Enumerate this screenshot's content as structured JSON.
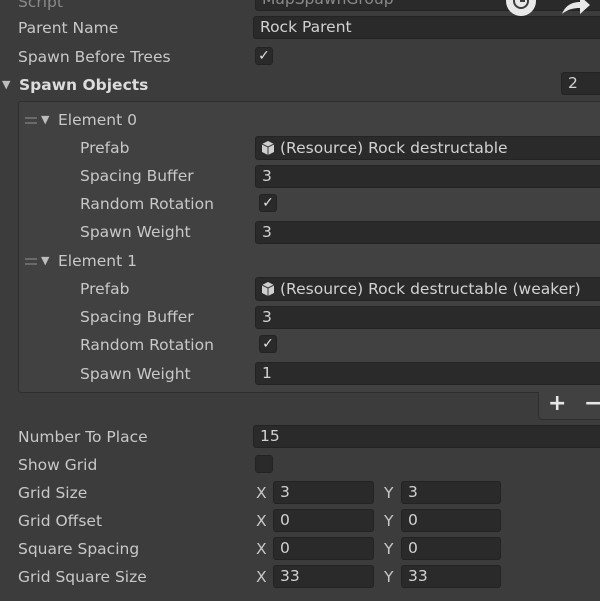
{
  "script_row": {
    "label": "Script",
    "value": "MapSpawnGroup"
  },
  "parent_name": {
    "label": "Parent Name",
    "value": "Rock Parent"
  },
  "spawn_before_trees": {
    "label": "Spawn Before Trees",
    "checked": true,
    "mark": "✓"
  },
  "spawn_objects": {
    "label": "Spawn Objects",
    "count": "2",
    "elements": [
      {
        "title": "Element 0",
        "prefab_label": "Prefab",
        "prefab_value": "(Resource) Rock destructable",
        "spacing_label": "Spacing Buffer",
        "spacing_value": "3",
        "rotation_label": "Random Rotation",
        "rotation_checked": true,
        "rotation_mark": "✓",
        "weight_label": "Spawn Weight",
        "weight_value": "3"
      },
      {
        "title": "Element 1",
        "prefab_label": "Prefab",
        "prefab_value": "(Resource) Rock destructable (weaker)",
        "spacing_label": "Spacing Buffer",
        "spacing_value": "3",
        "rotation_label": "Random Rotation",
        "rotation_checked": true,
        "rotation_mark": "✓",
        "weight_label": "Spawn Weight",
        "weight_value": "1"
      }
    ],
    "add_label": "+",
    "remove_label": "−"
  },
  "number_to_place": {
    "label": "Number To Place",
    "value": "15"
  },
  "show_grid": {
    "label": "Show Grid",
    "checked": false
  },
  "vectors": [
    {
      "label": "Grid Size",
      "x_axis": "X",
      "x": "3",
      "y_axis": "Y",
      "y": "3"
    },
    {
      "label": "Grid Offset",
      "x_axis": "X",
      "x": "0",
      "y_axis": "Y",
      "y": "0"
    },
    {
      "label": "Square Spacing",
      "x_axis": "X",
      "x": "0",
      "y_axis": "Y",
      "y": "0"
    },
    {
      "label": "Grid Square Size",
      "x_axis": "X",
      "x": "33",
      "y_axis": "Y",
      "y": "33"
    }
  ],
  "icons": {
    "foldout": "triangle-down-icon",
    "prefab": "cube-icon",
    "drag": "drag-handle-icon",
    "overlay_left": "clock-icon",
    "overlay_right": "share-arrow-icon"
  }
}
